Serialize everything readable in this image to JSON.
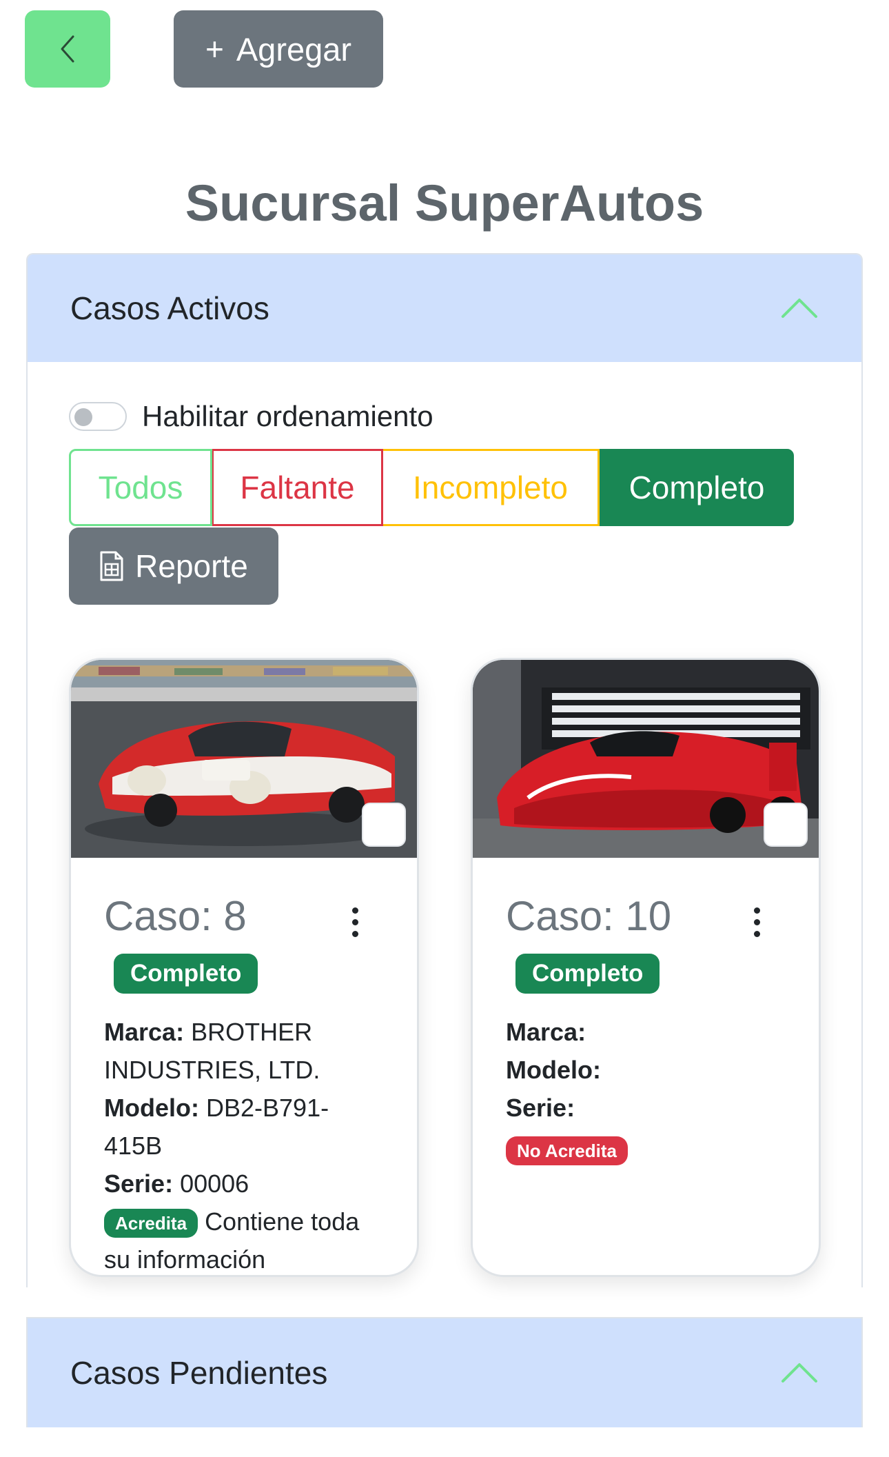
{
  "header": {
    "back_icon": "chevron-left-icon",
    "add_label": "Agregar",
    "add_icon": "plus-icon",
    "page_title": "Sucursal SuperAutos"
  },
  "active_section": {
    "title": "Casos Activos",
    "chevron_icon": "chevron-up-icon",
    "sort_toggle_label": "Habilitar ordenamiento",
    "sort_toggle_on": false,
    "filters": [
      {
        "label": "Todos",
        "color": "#6fe38f"
      },
      {
        "label": "Faltante",
        "color": "#dc3545"
      },
      {
        "label": "Incompleto",
        "color": "#ffc107"
      },
      {
        "label": "Completo",
        "color": "#198754",
        "selected": true
      }
    ],
    "report_label": "Reporte",
    "report_icon": "spreadsheet-file-icon",
    "cards": [
      {
        "title": "Caso: 8",
        "status": "Completo",
        "image": "red-white race car photo",
        "marca_label": "Marca:",
        "marca_value": "BROTHER INDUSTRIES, LTD.",
        "modelo_label": "Modelo:",
        "modelo_value": "DB2-B791-415B",
        "serie_label": "Serie:",
        "serie_value": "00006",
        "accredit_badge": "Acredita",
        "accredit_text": "Contiene toda su información"
      },
      {
        "title": "Caso: 10",
        "status": "Completo",
        "image": "red prototype race car in garage photo",
        "marca_label": "Marca:",
        "marca_value": "",
        "modelo_label": "Modelo:",
        "modelo_value": "",
        "serie_label": "Serie:",
        "serie_value": "",
        "accredit_badge": "No Acredita"
      }
    ]
  },
  "pending_section": {
    "title": "Casos Pendientes",
    "chevron_icon": "chevron-up-icon"
  },
  "colors": {
    "back_button": "#6fe38f",
    "gray_button": "#6c757d",
    "accordion_header": "#cfe0fd",
    "success": "#198754",
    "danger": "#dc3545",
    "warning": "#ffc107"
  }
}
